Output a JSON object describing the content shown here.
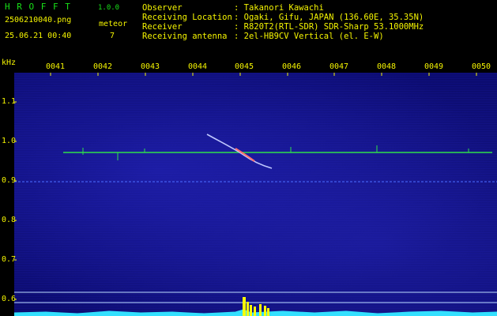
{
  "header": {
    "app_title": "H R O F F T",
    "app_version": "1.0.0",
    "file_name": "2506210040.png",
    "timestamp": "25.06.21 00:40",
    "type_label": "meteor",
    "type_count": "7",
    "info": [
      {
        "label": "Observer",
        "value": ": Takanori Kawachi"
      },
      {
        "label": "Receiving Location",
        "value": ": Ogaki, Gifu, JAPAN (136.60E, 35.35N)"
      },
      {
        "label": "Receiver",
        "value": ": R820T2(RTL-SDR) SDR-Sharp 53.1000MHz"
      },
      {
        "label": "Receiving antenna",
        "value": ": 2el-HB9CV Vertical (el. E-W)"
      }
    ]
  },
  "axes": {
    "y_unit": "kHz",
    "x_ticks": [
      "0041",
      "0042",
      "0043",
      "0044",
      "0045",
      "0046",
      "0047",
      "0048",
      "0049",
      "0050"
    ],
    "y_ticks": [
      "1.1",
      "1.0",
      "0.9",
      "0.8",
      "0.7",
      "0.6"
    ]
  },
  "colors": {
    "background": "#000000",
    "text": "#f5f500",
    "title": "#18e018",
    "spectrogram": "#0b0b70",
    "carrier": "#2ee04a",
    "meteor_trail": "#c0c8ff",
    "spectrum": "#33e0ff",
    "spectrum_peak": "#ffff00"
  }
}
